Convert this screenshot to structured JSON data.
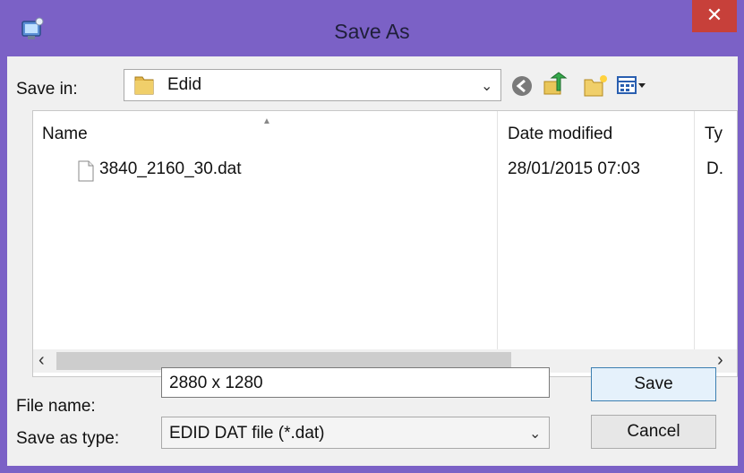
{
  "window": {
    "title": "Save As",
    "close_glyph": "✕"
  },
  "toolbar": {
    "save_in_label": "Save in:",
    "save_in_value": "Edid",
    "icons": [
      "back-icon",
      "up-folder-icon",
      "new-folder-icon",
      "view-menu-icon"
    ]
  },
  "file_list": {
    "columns": [
      "Name",
      "Date modified",
      "Ty"
    ],
    "rows": [
      {
        "name": "3840_2160_30.dat",
        "date": "28/01/2015 07:03",
        "type": "D."
      }
    ]
  },
  "scrollbar": {
    "left_arrow": "‹",
    "right_arrow": "›"
  },
  "form": {
    "file_name_label": "File name:",
    "file_name_value": "2880 x 1280",
    "save_as_type_label": "Save as type:",
    "save_as_type_value": "EDID DAT file (*.dat)",
    "save_label": "Save",
    "cancel_label": "Cancel"
  },
  "colors": {
    "frame": "#7b61c6",
    "close": "#c7403a",
    "client": "#f0f0f0"
  }
}
